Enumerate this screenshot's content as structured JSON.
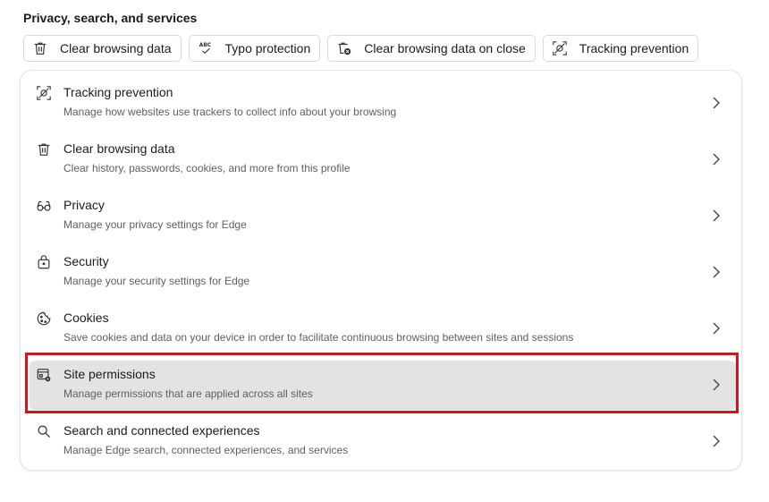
{
  "page": {
    "title": "Privacy, search, and services"
  },
  "chips": [
    {
      "label": "Clear browsing data",
      "icon": "trash-icon"
    },
    {
      "label": "Typo protection",
      "icon": "abc-check-icon"
    },
    {
      "label": "Clear browsing data on close",
      "icon": "trash-close-icon"
    },
    {
      "label": "Tracking prevention",
      "icon": "tracking-icon"
    }
  ],
  "rows": [
    {
      "title": "Tracking prevention",
      "desc": "Manage how websites use trackers to collect info about your browsing",
      "icon": "tracking-icon"
    },
    {
      "title": "Clear browsing data",
      "desc": "Clear history, passwords, cookies, and more from this profile",
      "icon": "trash-icon"
    },
    {
      "title": "Privacy",
      "desc": "Manage your privacy settings for Edge",
      "icon": "glasses-icon"
    },
    {
      "title": "Security",
      "desc": "Manage your security settings for Edge",
      "icon": "lock-icon"
    },
    {
      "title": "Cookies",
      "desc": "Save cookies and data on your device in order to facilitate continuous browsing between sites and sessions",
      "icon": "cookie-icon"
    },
    {
      "title": "Site permissions",
      "desc": "Manage permissions that are applied across all sites",
      "icon": "site-permissions-icon",
      "selected": true
    },
    {
      "title": "Search and connected experiences",
      "desc": "Manage Edge search, connected experiences, and services",
      "icon": "search-icon"
    }
  ],
  "colors": {
    "highlight": "#d0161c",
    "selected_bg": "#e3e3e3"
  }
}
